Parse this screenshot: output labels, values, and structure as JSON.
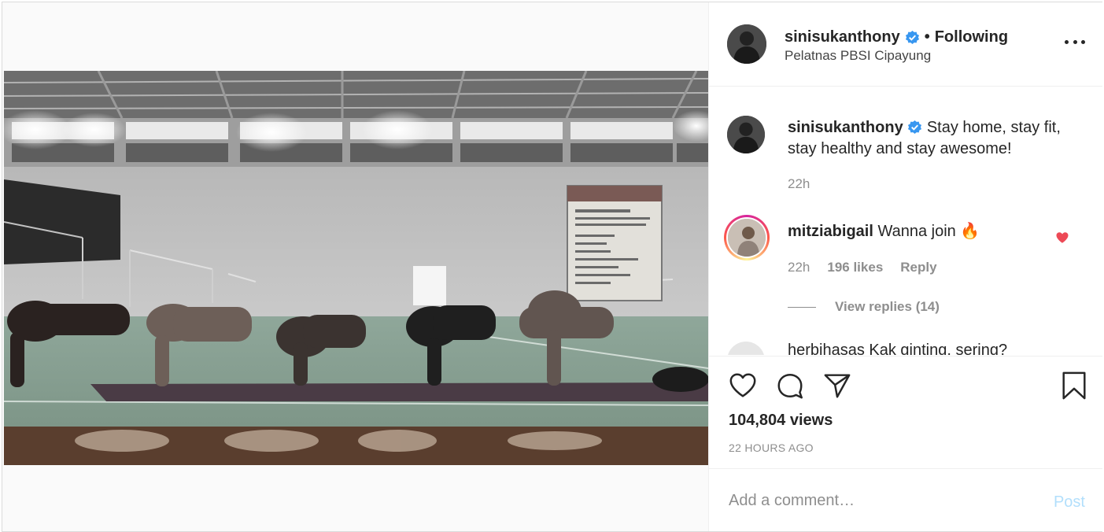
{
  "post": {
    "author": {
      "username": "sinisukanthony",
      "follow_status": "Following",
      "location": "Pelatnas PBSI Cipayung",
      "verified": true
    },
    "caption": {
      "username": "sinisukanthony",
      "text": "Stay home, stay fit, stay healthy and stay awesome!",
      "time": "22h"
    },
    "comments": [
      {
        "username": "mitziabigail",
        "text": "Wanna join 🔥",
        "time": "22h",
        "likes": "196 likes",
        "reply_label": "Reply",
        "view_replies": "View replies (14)",
        "liked_color": "#ed4956"
      }
    ],
    "partial_comment": "herbihasas Kak ginting, sering?",
    "views": "104,804 views",
    "posted": "22 HOURS AGO",
    "add_comment_placeholder": "Add a comment…",
    "post_label": "Post"
  },
  "icons": {
    "more": "more-horizontal-icon",
    "verified": "verified-badge-icon",
    "like": "heart-outline-icon",
    "comment": "comment-bubble-icon",
    "share": "paper-plane-icon",
    "save": "bookmark-icon",
    "tag": "user-tag-icon"
  },
  "colors": {
    "verified": "#3897f0",
    "liked": "#ed4956",
    "post_disabled": "#b2dffc",
    "secondary_text": "#8e8e8e"
  }
}
